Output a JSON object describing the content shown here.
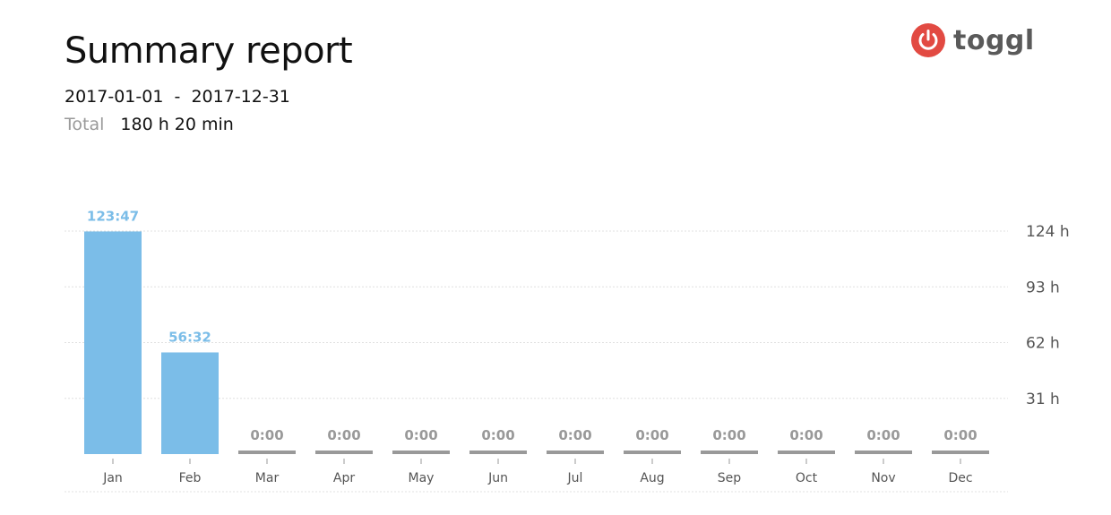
{
  "report": {
    "title": "Summary report",
    "date_start": "2017-01-01",
    "date_separator": "-",
    "date_end": "2017-12-31",
    "total_label": "Total",
    "total_value": "180 h 20 min"
  },
  "brand": {
    "name": "toggl",
    "icon": "power-icon",
    "color": "#e24a42"
  },
  "colors": {
    "bar": "#7bbde8",
    "zero_bar": "#999999",
    "bar_label": "#7bbde8",
    "zero_label": "#999999",
    "grid": "#e0e0e0"
  },
  "chart_data": {
    "type": "bar",
    "categories": [
      "Jan",
      "Feb",
      "Mar",
      "Apr",
      "May",
      "Jun",
      "Jul",
      "Aug",
      "Sep",
      "Oct",
      "Nov",
      "Dec"
    ],
    "values": [
      123.7833,
      56.5333,
      0,
      0,
      0,
      0,
      0,
      0,
      0,
      0,
      0,
      0
    ],
    "data_labels": [
      "123:47",
      "56:32",
      "0:00",
      "0:00",
      "0:00",
      "0:00",
      "0:00",
      "0:00",
      "0:00",
      "0:00",
      "0:00",
      "0:00"
    ],
    "y_ticks": [
      {
        "value": 124,
        "label": "124 h"
      },
      {
        "value": 93,
        "label": "93 h"
      },
      {
        "value": 62,
        "label": "62 h"
      },
      {
        "value": 31,
        "label": "31 h"
      }
    ],
    "ylim": [
      0,
      124
    ],
    "grid": true,
    "y_axis_position": "right"
  }
}
